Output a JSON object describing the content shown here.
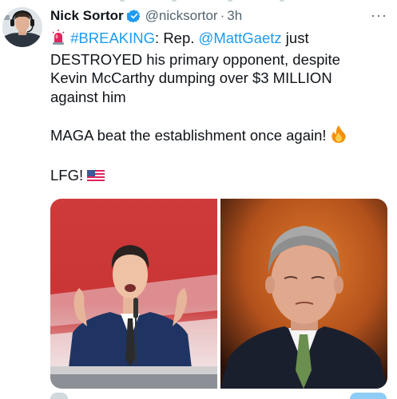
{
  "tweet": {
    "author_name": "Nick Sortor",
    "handle": "@nicksortor",
    "separator": "·",
    "time": "3h",
    "more_label": "···",
    "line1_tag": "#BREAKING",
    "line1_after_tag": ": Rep. ",
    "line1_mention": "@MattGaetz",
    "line1_end": " just",
    "line2": "DESTROYED his primary opponent, despite",
    "line3": "Kevin McCarthy dumping over $3 MILLION",
    "line4": "against him",
    "line5": "MAGA beat the establishment once again!",
    "line6": "LFG!",
    "images": [
      "photo-left",
      "photo-right"
    ]
  },
  "colors": {
    "accent": "#1d9bf0",
    "secondary_text": "#536471",
    "text": "#0f1419"
  }
}
